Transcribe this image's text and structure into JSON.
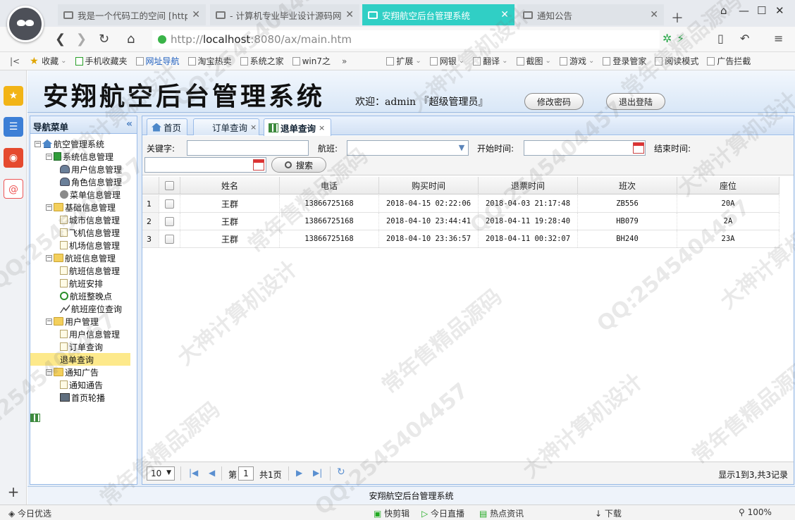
{
  "browser": {
    "tabs": [
      {
        "title": "我是一个代码工的空间 [http:"
      },
      {
        "title": "- 计算机专业毕业设计源码网"
      },
      {
        "title": "安翔航空后台管理系统"
      },
      {
        "title": "通知公告"
      }
    ],
    "url_prefix": "http://",
    "url_host": "localhost",
    "url_rest": ":8080/ax/main.htm",
    "bookmarks": [
      "收藏",
      "手机收藏夹",
      "网址导航",
      "淘宝热卖",
      "系统之家",
      "win7之"
    ],
    "right_tools": [
      "扩展",
      "网银",
      "翻译",
      "截图",
      "游戏",
      "登录管家",
      "阅读模式",
      "广告拦截"
    ]
  },
  "app": {
    "title": "安翔航空后台管理系统",
    "welcome": "欢迎：admin 『超级管理员』",
    "change_pwd": "修改密码",
    "logout": "退出登陆",
    "nav_title": "导航菜单",
    "footer": "安翔航空后台管理系统"
  },
  "tree": [
    {
      "label": "航空管理系统",
      "depth": 0,
      "icon": "home",
      "exp": true
    },
    {
      "label": "系统信息管理",
      "depth": 1,
      "icon": "green",
      "exp": true
    },
    {
      "label": "用户信息管理",
      "depth": 2,
      "icon": "user"
    },
    {
      "label": "角色信息管理",
      "depth": 2,
      "icon": "user"
    },
    {
      "label": "菜单信息管理",
      "depth": 2,
      "icon": "gear"
    },
    {
      "label": "基础信息管理",
      "depth": 1,
      "icon": "folder",
      "exp": true
    },
    {
      "label": "城市信息管理",
      "depth": 2,
      "icon": "doc"
    },
    {
      "label": "飞机信息管理",
      "depth": 2,
      "icon": "doc"
    },
    {
      "label": "机场信息管理",
      "depth": 2,
      "icon": "doc"
    },
    {
      "label": "航班信息管理",
      "depth": 1,
      "icon": "folder",
      "exp": true
    },
    {
      "label": "航班信息管理",
      "depth": 2,
      "icon": "doc"
    },
    {
      "label": "航班安排",
      "depth": 2,
      "icon": "doc"
    },
    {
      "label": "航班整晚点",
      "depth": 2,
      "icon": "clock"
    },
    {
      "label": "航班座位查询",
      "depth": 2,
      "icon": "seat"
    },
    {
      "label": "用户管理",
      "depth": 1,
      "icon": "folder",
      "exp": true
    },
    {
      "label": "用户信息管理",
      "depth": 2,
      "icon": "doc"
    },
    {
      "label": "订单查询",
      "depth": 2,
      "icon": "doc"
    },
    {
      "label": "退单查询",
      "depth": 2,
      "icon": "grid",
      "selected": true
    },
    {
      "label": "通知广告",
      "depth": 1,
      "icon": "folder",
      "exp": true
    },
    {
      "label": "通知通告",
      "depth": 2,
      "icon": "doc"
    },
    {
      "label": "首页轮播",
      "depth": 2,
      "icon": "img"
    }
  ],
  "panel_tabs": [
    "首页",
    "订单查询",
    "退单查询"
  ],
  "search": {
    "keyword_label": "关键字:",
    "flight_label": "航班:",
    "start_label": "开始时间:",
    "end_label": "结束时间:",
    "button": "搜索"
  },
  "table": {
    "columns": [
      "姓名",
      "电话",
      "购买时间",
      "退票时间",
      "班次",
      "座位"
    ],
    "rows": [
      [
        "王群",
        "13866725168",
        "2018-04-15 02:22:06",
        "2018-04-03 21:17:48",
        "ZB556",
        "20A"
      ],
      [
        "王群",
        "13866725168",
        "2018-04-10 23:44:41",
        "2018-04-11 19:28:40",
        "HB079",
        "2A"
      ],
      [
        "王群",
        "13866725168",
        "2018-04-10 23:36:57",
        "2018-04-11 00:32:07",
        "BH240",
        "23A"
      ]
    ]
  },
  "pager": {
    "page_size": "10",
    "page_prefix": "第",
    "page": "1",
    "page_suffix": "共1页",
    "summary": "显示1到3,共3记录"
  },
  "statusbar": [
    "今日优选",
    "快剪辑",
    "今日直播",
    "热点资讯",
    "下载",
    "100%"
  ],
  "watermarks": [
    "QQ:2545404457",
    "大神计算机设计",
    "常年售精品源码"
  ]
}
